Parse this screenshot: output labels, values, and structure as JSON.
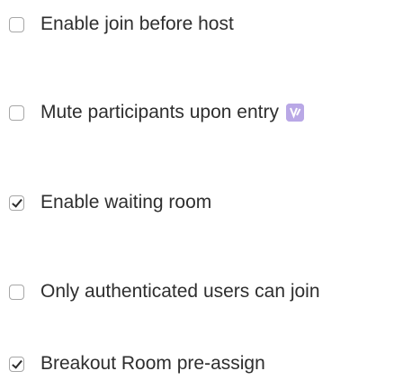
{
  "options": [
    {
      "label": "Enable join before host",
      "checked": false
    },
    {
      "label": "Mute participants upon entry",
      "checked": false,
      "badge_icon": "feature-badge-icon",
      "badge_color": "#b9a8e6"
    },
    {
      "label": "Enable waiting room",
      "checked": true
    },
    {
      "label": "Only authenticated users can join",
      "checked": false
    },
    {
      "label": "Breakout Room pre-assign",
      "checked": true
    }
  ]
}
